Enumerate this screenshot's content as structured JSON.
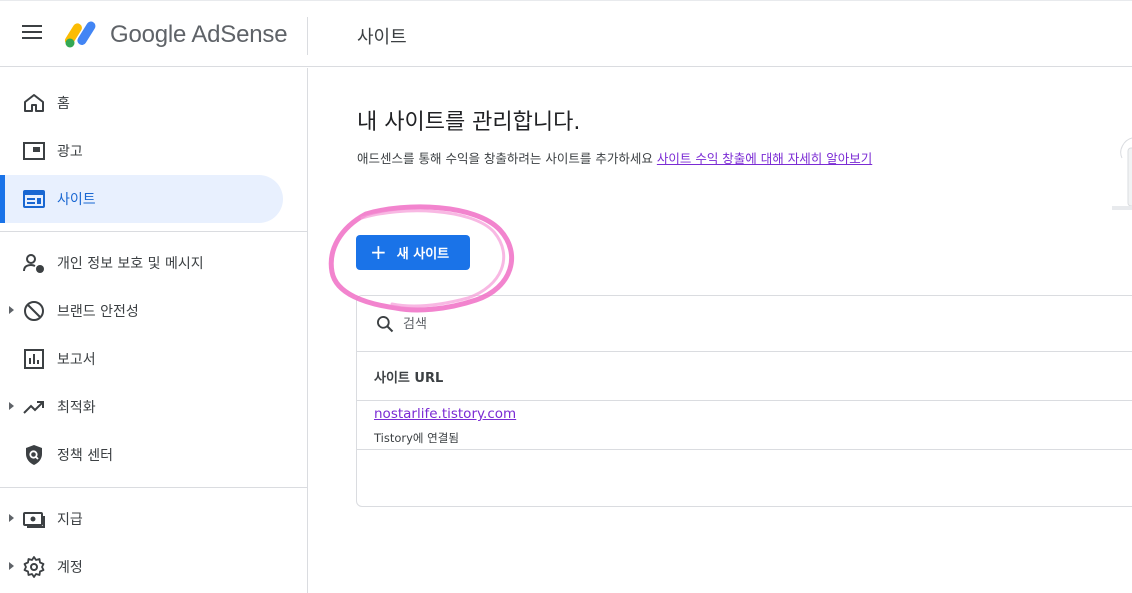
{
  "header": {
    "brand": "Google AdSense",
    "page_title": "사이트"
  },
  "sidebar": {
    "items": [
      {
        "label": "홈",
        "icon": "home-icon"
      },
      {
        "label": "광고",
        "icon": "ads-icon"
      },
      {
        "label": "사이트",
        "icon": "sites-icon",
        "active": true
      },
      {
        "label": "개인 정보 보호 및 메시지",
        "icon": "privacy-icon"
      },
      {
        "label": "브랜드 안전성",
        "icon": "block-icon",
        "expandable": true
      },
      {
        "label": "보고서",
        "icon": "reports-icon"
      },
      {
        "label": "최적화",
        "icon": "trending-icon",
        "expandable": true
      },
      {
        "label": "정책 센터",
        "icon": "policy-shield-icon"
      },
      {
        "label": "지급",
        "icon": "payments-icon",
        "expandable": true
      },
      {
        "label": "계정",
        "icon": "gear-icon",
        "expandable": true
      }
    ]
  },
  "main": {
    "title": "내 사이트를 관리합니다.",
    "description": "애드센스를 통해 수익을 창출하려는 사이트를 추가하세요",
    "learn_more_link": "사이트 수익 창출에 대해 자세히 알아보기",
    "new_site_button": "새 사이트",
    "search_placeholder": "검색",
    "column_header": "사이트 URL",
    "sites": [
      {
        "url": "nostarlife.tistory.com",
        "status": "Tistory에 연결됨"
      }
    ]
  },
  "colors": {
    "accent": "#1a73e8",
    "active_bg": "#e8f0fe",
    "link": "#7b2bd4",
    "annotation": "#f06ec5"
  }
}
